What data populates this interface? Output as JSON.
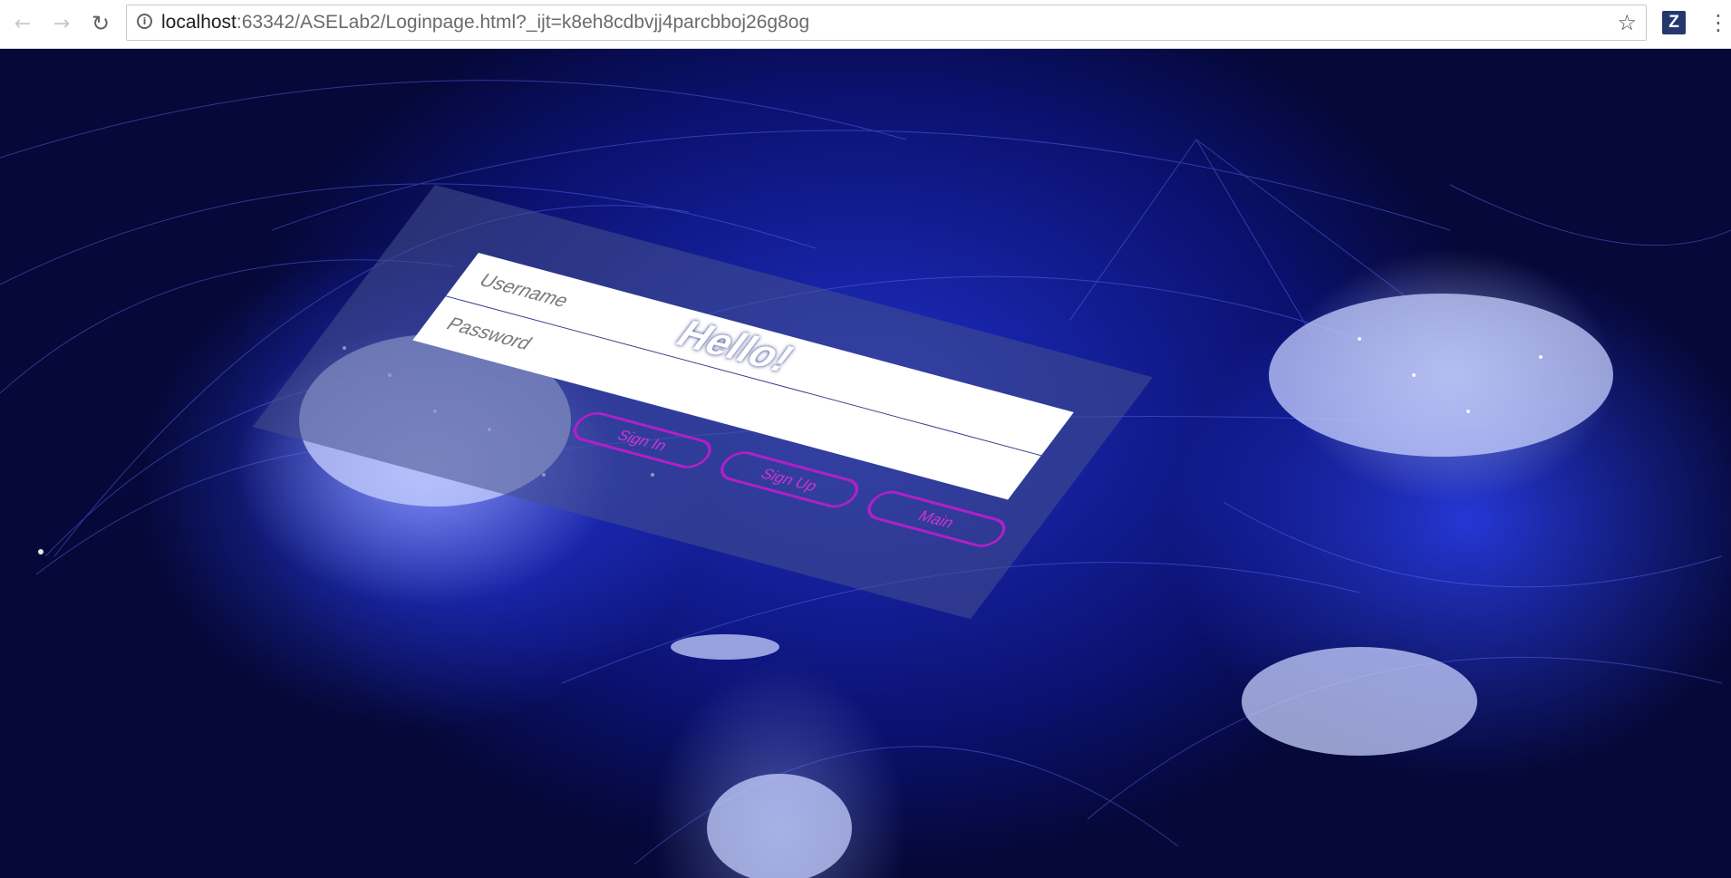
{
  "browser": {
    "back_icon": "arrow-left-icon",
    "forward_icon": "arrow-right-icon",
    "reload_icon": "reload-icon",
    "info_icon": "info-icon",
    "url_host": "localhost",
    "url_rest": ":63342/ASELab2/Loginpage.html?_ijt=k8eh8cdbvjj4parcbboj26g8og",
    "bookmark_icon": "star-icon",
    "extension_label": "Z",
    "menu_icon": "kebab-menu-icon"
  },
  "page": {
    "background": "world-map-connections",
    "colors": {
      "accent": "#b21fc9",
      "panel": "#465088",
      "map_blue": "#1f2fc8"
    }
  },
  "login": {
    "title": "Hello!",
    "username_placeholder": "Username",
    "password_placeholder": "Password",
    "buttons": [
      {
        "label": "Sign In"
      },
      {
        "label": "Sign Up"
      },
      {
        "label": "Main"
      }
    ]
  }
}
